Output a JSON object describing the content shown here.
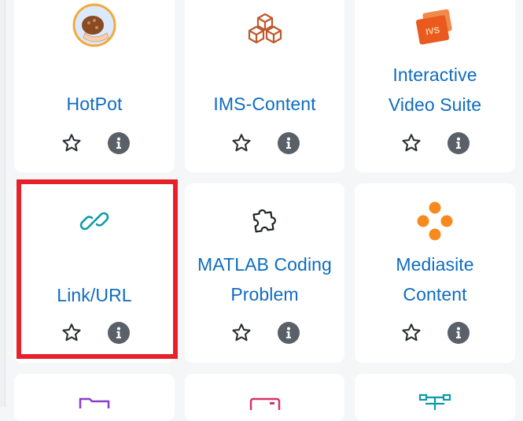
{
  "modules": [
    {
      "name": "HotPot",
      "icon": "hotpot-icon"
    },
    {
      "name": "IMS-Content",
      "icon": "ims-content-icon"
    },
    {
      "name_lines": [
        "Interactive",
        "Video Suite"
      ],
      "icon": "interactive-video-suite-icon"
    },
    {
      "name": "Link/URL",
      "icon": "link-icon"
    },
    {
      "name_lines": [
        "MATLAB Coding",
        "Problem"
      ],
      "icon": "puzzle-icon"
    },
    {
      "name_lines": [
        "Mediasite",
        "Content"
      ],
      "icon": "mediasite-icon"
    }
  ],
  "actions": {
    "star": "star-icon",
    "info": "info-icon"
  },
  "colors": {
    "link_text": "#0f6cbf",
    "highlight": "#e8202a",
    "info_bg": "#5a6068",
    "ims_orange": "#c0582a",
    "mediasite_orange": "#f68a1e",
    "link_teal": "#0e9aa7",
    "ivs_orange": "#ea5a1e",
    "purple_partial": "#8b3ec8",
    "pink_partial": "#d6336c",
    "teal_partial": "#0e9aa7"
  }
}
